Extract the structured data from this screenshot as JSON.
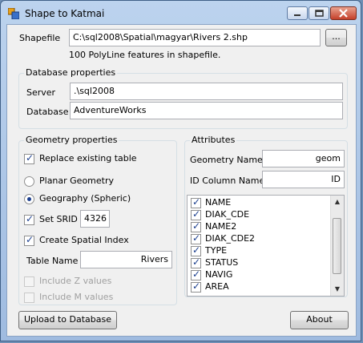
{
  "window": {
    "title": "Shape to Katmai"
  },
  "shapefile": {
    "label": "Shapefile",
    "path": "C:\\sql2008\\Spatial\\magyar\\Rivers 2.shp",
    "browse_label": "...",
    "info": "100 PolyLine features in shapefile."
  },
  "database": {
    "legend": "Database properties",
    "server_label": "Server",
    "server_value": ".\\sql2008",
    "db_label": "Database",
    "db_value": "AdventureWorks"
  },
  "geometry": {
    "legend": "Geometry properties",
    "replace_label": "Replace existing table",
    "replace_checked": true,
    "planar_label": "Planar Geometry",
    "geography_label": "Geography (Spheric)",
    "selected_type": "geography",
    "srid_label": "Set SRID",
    "srid_checked": true,
    "srid_value": "4326",
    "index_label": "Create Spatial Index",
    "index_checked": true,
    "table_label": "Table Name",
    "table_value": "Rivers",
    "z_label": "Include Z values",
    "m_label": "Include M values"
  },
  "attributes": {
    "legend": "Attributes",
    "geom_name_label": "Geometry Name",
    "geom_name_value": "geom",
    "id_label": "ID Column Name",
    "id_value": "ID",
    "columns": [
      {
        "name": "NAME",
        "checked": true
      },
      {
        "name": "DIAK_CDE",
        "checked": true
      },
      {
        "name": "NAME2",
        "checked": true
      },
      {
        "name": "DIAK_CDE2",
        "checked": true
      },
      {
        "name": "TYPE",
        "checked": true
      },
      {
        "name": "STATUS",
        "checked": true
      },
      {
        "name": "NAVIG",
        "checked": true
      },
      {
        "name": "AREA",
        "checked": true
      }
    ]
  },
  "buttons": {
    "upload": "Upload to Database",
    "about": "About"
  },
  "icons": {
    "app": "app-icon",
    "minimize": "minimize-icon",
    "maximize": "maximize-icon",
    "close": "close-icon",
    "scroll_up": "scroll-up-arrow-icon",
    "scroll_down": "scroll-down-arrow-icon"
  }
}
